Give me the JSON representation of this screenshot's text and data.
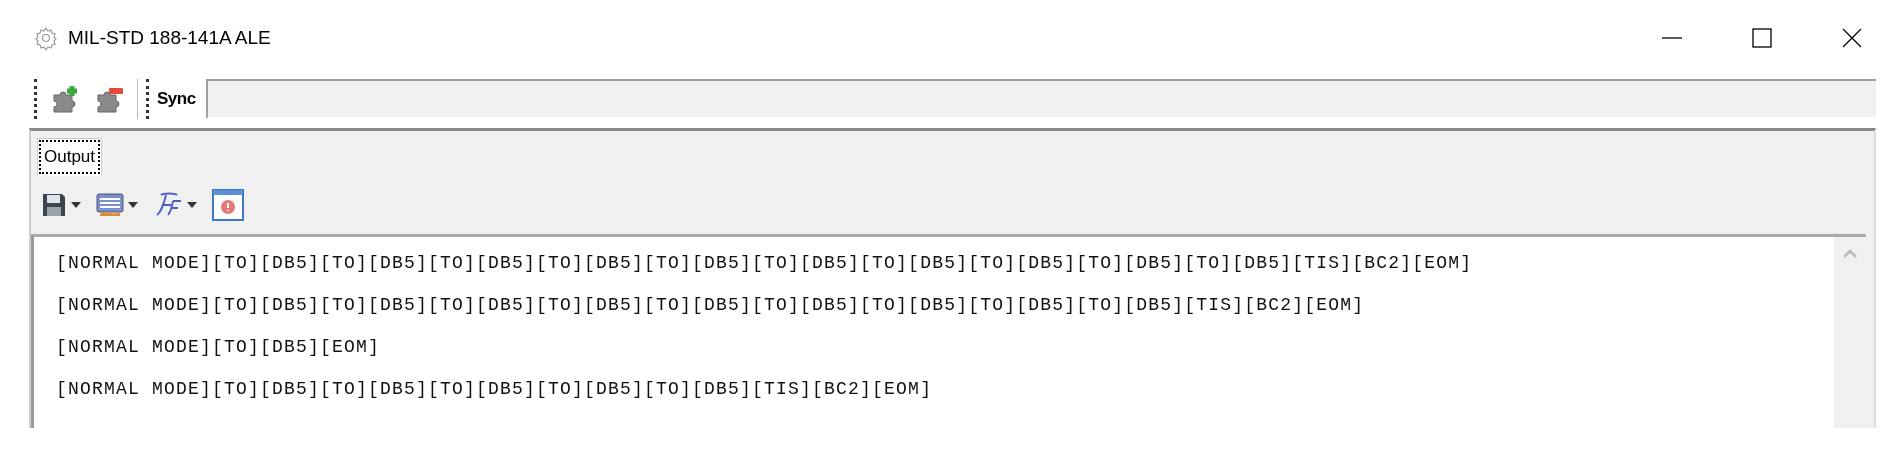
{
  "window": {
    "title": "MIL-STD 188-141A ALE"
  },
  "toolbar": {
    "label": "Sync"
  },
  "tabs": [
    {
      "label": "Output",
      "selected": true
    }
  ],
  "output_lines": [
    "[NORMAL MODE][TO][DB5][TO][DB5][TO][DB5][TO][DB5][TO][DB5][TO][DB5][TO][DB5][TO][DB5][TO][DB5][TO][DB5][TIS][BC2][EOM]",
    "[NORMAL MODE][TO][DB5][TO][DB5][TO][DB5][TO][DB5][TO][DB5][TO][DB5][TO][DB5][TO][DB5][TO][DB5][TIS][BC2][EOM]",
    "[NORMAL MODE][TO][DB5][EOM]",
    "[NORMAL MODE][TO][DB5][TO][DB5][TO][DB5][TO][DB5][TO][DB5][TIS][BC2][EOM]"
  ]
}
